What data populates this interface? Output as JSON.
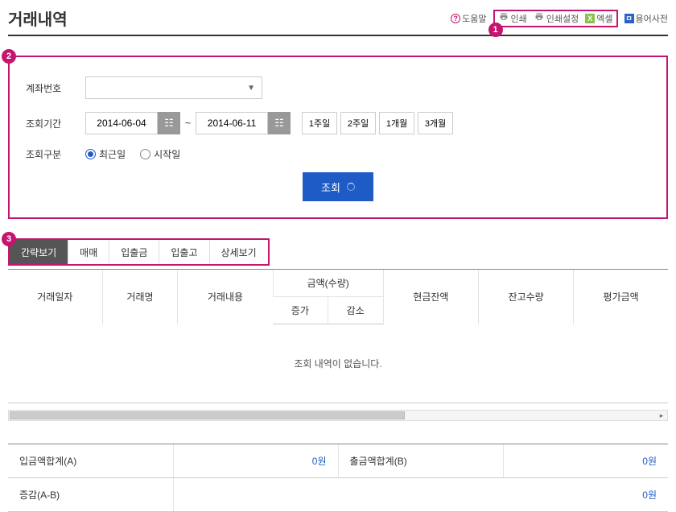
{
  "header": {
    "title": "거래내역",
    "links": {
      "help": "도움말",
      "print": "인쇄",
      "printSettings": "인쇄설정",
      "excel": "엑셀",
      "dictionary": "용어사전"
    }
  },
  "annotations": {
    "print": "1",
    "search": "2",
    "tabs": "3"
  },
  "search": {
    "account": {
      "label": "계좌번호",
      "value": ""
    },
    "period": {
      "label": "조회기간",
      "from": "2014-06-04",
      "to": "2014-06-11",
      "tilde": "~",
      "ranges": [
        "1주일",
        "2주일",
        "1개월",
        "3개월"
      ]
    },
    "criteria": {
      "label": "조회구분",
      "options": [
        "최근일",
        "시작일"
      ],
      "selected": "최근일"
    },
    "submit": "조회"
  },
  "tabs": {
    "items": [
      "간략보기",
      "매매",
      "입출금",
      "입출고",
      "상세보기"
    ],
    "active": "간략보기"
  },
  "grid": {
    "headers": {
      "date": "거래일자",
      "name": "거래명",
      "desc": "거래내용",
      "amountGroup": "금액(수량)",
      "inc": "증가",
      "dec": "감소",
      "cash": "현금잔액",
      "qty": "잔고수량",
      "eval": "평가금액"
    },
    "empty": "조회 내역이 없습니다."
  },
  "summary": {
    "depositLabel": "입금액합계(A)",
    "depositValue": "0원",
    "withdrawLabel": "출금액합계(B)",
    "withdrawValue": "0원",
    "diffLabel": "증감(A-B)",
    "diffValue": "0원"
  }
}
